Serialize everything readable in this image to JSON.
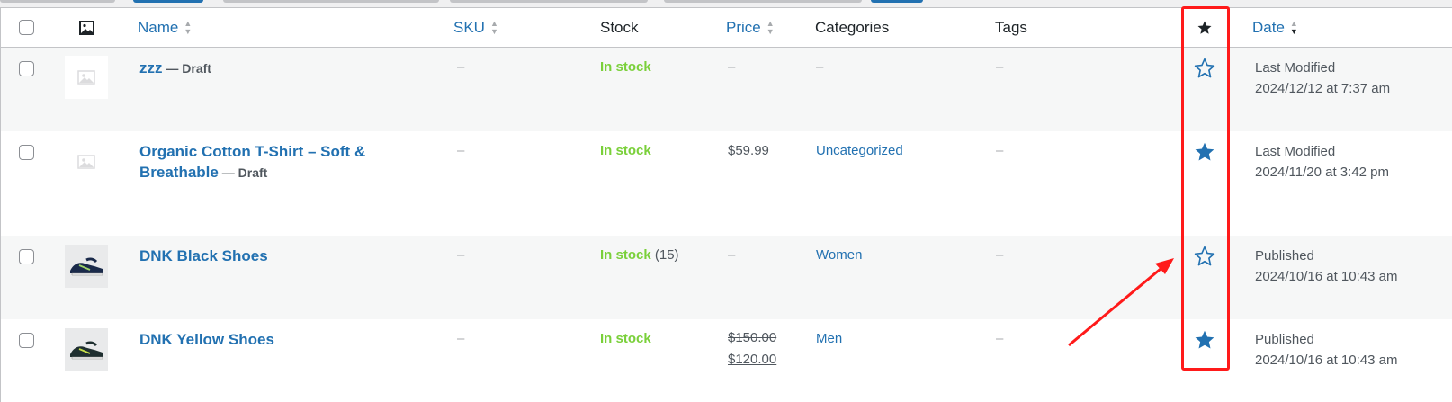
{
  "columns": {
    "name": "Name",
    "sku": "SKU",
    "stock": "Stock",
    "price": "Price",
    "categories": "Categories",
    "tags": "Tags",
    "featured_icon": "star-icon",
    "date": "Date"
  },
  "rows": [
    {
      "name_line1": "zzz",
      "name_line2": "",
      "draft_label": " — Draft",
      "thumbnail": "placeholder-image-icon",
      "sku": "–",
      "stock": "In stock",
      "stock_qty": "",
      "price": "–",
      "price_old": "",
      "price_new": "",
      "category": "–",
      "tags": "–",
      "featured": false,
      "date_status": "Last Modified",
      "date_value": "2024/12/12 at 7:37 am"
    },
    {
      "name_line1": "Organic Cotton T-Shirt – Soft &",
      "name_line2": "Breathable",
      "draft_label": " — Draft",
      "thumbnail": "placeholder-image-icon",
      "sku": "–",
      "stock": "In stock",
      "stock_qty": "",
      "price": "$59.99",
      "price_old": "",
      "price_new": "",
      "category": "Uncategorized",
      "tags": "–",
      "featured": true,
      "date_status": "Last Modified",
      "date_value": "2024/11/20 at 3:42 pm"
    },
    {
      "name_line1": "DNK Black Shoes",
      "name_line2": "",
      "draft_label": "",
      "thumbnail": "shoe-thumbnail",
      "sku": "–",
      "stock": "In stock",
      "stock_qty": " (15)",
      "price": "–",
      "price_old": "",
      "price_new": "",
      "category": "Women",
      "tags": "–",
      "featured": false,
      "date_status": "Published",
      "date_value": "2024/10/16 at 10:43 am"
    },
    {
      "name_line1": "DNK Yellow Shoes",
      "name_line2": "",
      "draft_label": "",
      "thumbnail": "shoe-thumbnail",
      "sku": "–",
      "stock": "In stock",
      "stock_qty": "",
      "price": "",
      "price_old": "$150.00",
      "price_new": "$120.00",
      "category": "Men",
      "tags": "–",
      "featured": true,
      "date_status": "Published",
      "date_value": "2024/10/16 at 10:43 am"
    }
  ],
  "colors": {
    "link": "#2271b1",
    "in_stock": "#7ad03a",
    "annotation": "#ff1a1a"
  }
}
